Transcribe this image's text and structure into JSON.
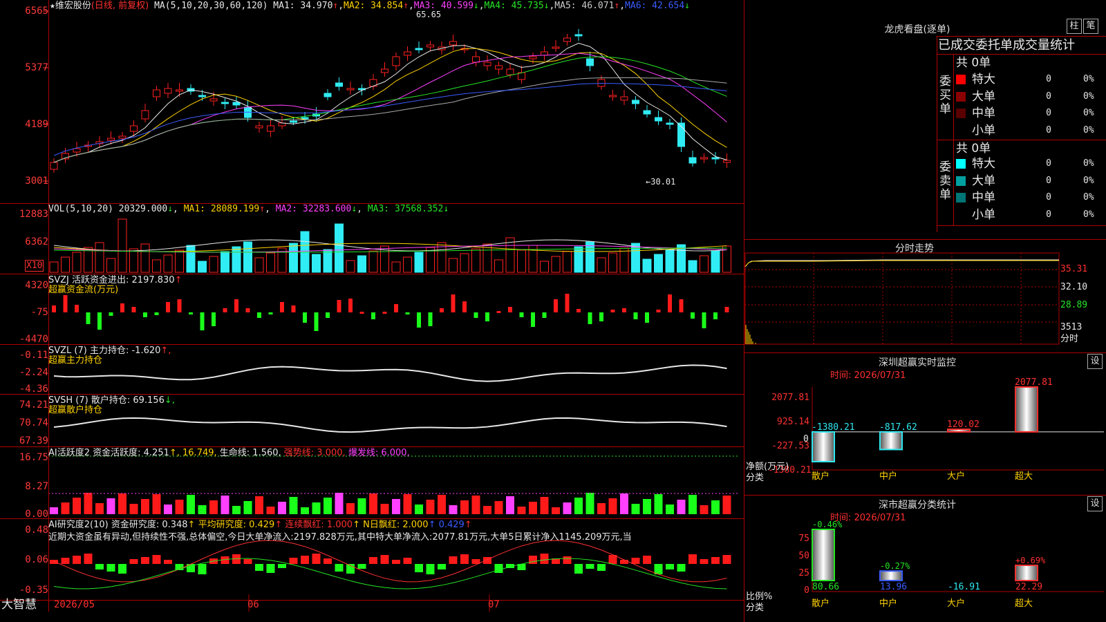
{
  "chart_header": {
    "stock_name": "维宏股份",
    "period": "(日线, 前复权)",
    "ma_label": "MA(5,10,20,30,60,120)",
    "ma_values": [
      {
        "label": "MA1: 34.970",
        "arrow": "↑",
        "color": "#e8e8e8"
      },
      {
        "label": "MA2: 34.854",
        "arrow": "↑",
        "color": "#ffd200"
      },
      {
        "label": "MA3: 40.599",
        "arrow": "↓",
        "color": "#ff40ff"
      },
      {
        "label": "MA4: 45.735",
        "arrow": "↓",
        "color": "#26e626"
      },
      {
        "label": "MA5: 46.071",
        "arrow": "↑",
        "color": "#cccccc"
      },
      {
        "label": "MA6: 42.654",
        "arrow": "↓",
        "color": "#3a5cff"
      }
    ],
    "star": "★",
    "high_mark": "65.65",
    "low_mark": "←30.01"
  },
  "price_axis": [
    "6565",
    "5377",
    "4189",
    "3001"
  ],
  "vol": {
    "label": "VOL(5,10,20)",
    "value": "20329.000",
    "arrow": "↓",
    "ma1": "MA1: 28089.199",
    "ma1_arrow": "↑",
    "ma2": "MA2: 32283.600",
    "ma2_arrow": "↓",
    "ma3": "MA3: 37568.352",
    "ma3_arrow": "↓",
    "axis": [
      "12883",
      "6362"
    ],
    "unit": "X10"
  },
  "svzj": {
    "label": "SVZJ  活跃资金进出: 2197.830",
    "arrow": "↑",
    "sub": "超赢资金流(万元)",
    "axis": [
      "4320",
      "-75",
      "-4470"
    ]
  },
  "svzl": {
    "label": "SVZL (7) 主力持仓: -1.620",
    "arrow": "↑,",
    "sub": "超赢主力持仓",
    "axis": [
      "-0.11",
      "-2.24",
      "-4.36"
    ]
  },
  "svsh": {
    "label": "SVSH (7) 散户持仓: 69.156",
    "arrow": "↓,",
    "sub": "超赢散户持仓",
    "axis": [
      "74.21",
      "70.74",
      "67.39"
    ]
  },
  "ai1": {
    "label": "AI活跃度2 资金活跃度: 4.251",
    "v2": "↑, 16.749,",
    "v3": "生命线: 1.560,",
    "v4": "强势线: 3.000,",
    "v5": "爆发线: 6.000,",
    "axis": [
      "16.75",
      "8.27",
      "0.00"
    ]
  },
  "ai2": {
    "label": "AI研究度2(10) 资金研究度: 0.348",
    "v2": "↑ 平均研究度: 0.429",
    "v3": "↑ 连续飘红: 1.000",
    "v4": "↑ N日飘红: 2.000",
    "v5": "↑ 0.429",
    "v6": "↑",
    "commentary": "近期大资金虽有异动,但持续性不强,总体偏空,今日大单净流入:2197.828万元,其中特大单净流入:2077.81万元,大单5日累计净入1145.209万元,当",
    "axis": [
      "0.48",
      "0.06",
      "-0.35"
    ]
  },
  "bottom": {
    "brand": "大智慧",
    "dates": [
      "2026/05",
      "06",
      "07"
    ]
  },
  "longhu": {
    "title": "龙虎看盘(逐单)",
    "tab1": "柱",
    "tab2": "笔",
    "subtitle": "已成交委托单成交量统计",
    "buy_total": "共 0单",
    "sell_total": "共 0单",
    "buy_side": "委买单",
    "sell_side": "委卖单",
    "buy_rows": [
      {
        "name": "特大",
        "count": "0",
        "pct": "0%",
        "color": "#ff0000"
      },
      {
        "name": "大单",
        "count": "0",
        "pct": "0%",
        "color": "#8b0000"
      },
      {
        "name": "中单",
        "count": "0",
        "pct": "0%",
        "color": "#5a0000"
      },
      {
        "name": "小单",
        "count": "0",
        "pct": "0%",
        "color": "#000000"
      }
    ],
    "sell_rows": [
      {
        "name": "特大",
        "count": "0",
        "pct": "0%",
        "color": "#00ffff"
      },
      {
        "name": "大单",
        "count": "0",
        "pct": "0%",
        "color": "#00a0a0"
      },
      {
        "name": "中单",
        "count": "0",
        "pct": "0%",
        "color": "#007575"
      },
      {
        "name": "小单",
        "count": "0",
        "pct": "0%",
        "color": "#000000"
      }
    ]
  },
  "fenshi": {
    "title": "分时走势",
    "p1": "35.31",
    "p2": "32.10",
    "p3": "28.89",
    "vol": "3513",
    "unit": "分时"
  },
  "monitor": {
    "title": "深圳超赢实时监控",
    "set": "设",
    "time": "时间: 2026/07/31",
    "axis": [
      "2077.81",
      "925.14",
      "-227.53",
      "-1380.21"
    ],
    "zero": "0",
    "ylabel": "净额(万元)",
    "xlabel": "分类",
    "cats": [
      "散户",
      "中户",
      "大户",
      "超大"
    ],
    "vals_text": [
      "-1380.21",
      "-817.62",
      "120.02",
      "2077.81"
    ],
    "chart_data": {
      "type": "bar",
      "categories": [
        "散户",
        "中户",
        "大户",
        "超大"
      ],
      "values": [
        -1380.21,
        -817.62,
        120.02,
        2077.81
      ],
      "ylabel": "净额(万元)",
      "xlabel": "分类",
      "ylim": [
        -1380.21,
        2077.81
      ]
    }
  },
  "classify": {
    "title": "深市超赢分类统计",
    "set": "设",
    "time": "时间: 2026/07/31",
    "axis": [
      "75",
      "50",
      "25",
      "0"
    ],
    "ylabel": "比例%",
    "xlabel": "分类",
    "cats": [
      "散户",
      "中户",
      "大户",
      "超大"
    ],
    "top": [
      "-0.46%",
      "-0.27%",
      "",
      "+0.69%"
    ],
    "bottom": [
      "80.66",
      "13.96",
      "-16.91",
      "22.29"
    ],
    "chart_data": {
      "type": "bar",
      "categories": [
        "散户",
        "中户",
        "大户",
        "超大"
      ],
      "values": [
        80.66,
        13.96,
        -16.91,
        22.29
      ],
      "changes": [
        "-0.46%",
        "-0.27%",
        "",
        "+0.69%"
      ],
      "ylabel": "比例%",
      "xlabel": "分类",
      "ylim": [
        0,
        75
      ]
    }
  }
}
